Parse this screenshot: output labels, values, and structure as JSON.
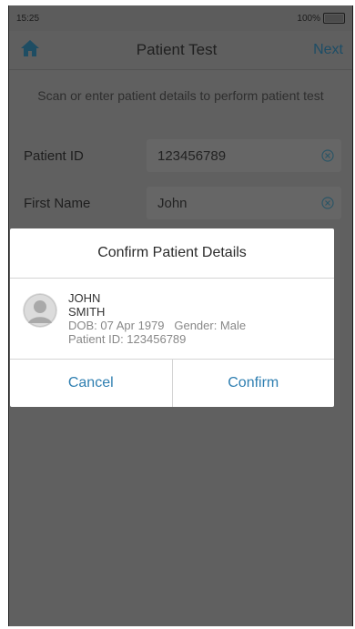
{
  "statusbar": {
    "time": "15:25",
    "battery": "100%"
  },
  "navbar": {
    "title": "Patient Test",
    "next_label": "Next"
  },
  "instructions": "Scan or enter patient details to perform patient test",
  "form": {
    "patient_id": {
      "label": "Patient ID",
      "value": "123456789"
    },
    "first_name": {
      "label": "First Name",
      "value": "John"
    }
  },
  "dialog": {
    "title": "Confirm Patient Details",
    "patient": {
      "first_name": "JOHN",
      "last_name": "SMITH",
      "dob_gender": "DOB: 07 Apr 1979   Gender: Male",
      "patient_id": "Patient ID: 123456789"
    },
    "cancel_label": "Cancel",
    "confirm_label": "Confirm"
  },
  "icons": {
    "home": "home-icon",
    "clear": "clear-circle-icon",
    "avatar": "person-avatar-icon"
  },
  "colors": {
    "accent": "#2f7fb1",
    "overlay": "#606060"
  }
}
